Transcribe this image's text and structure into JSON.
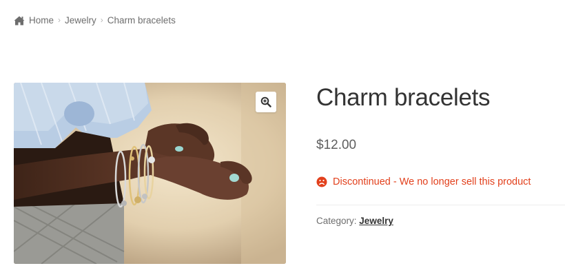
{
  "breadcrumb": {
    "home": "Home",
    "separator": "›",
    "category": "Jewelry",
    "current": "Charm bracelets"
  },
  "product": {
    "title": "Charm bracelets",
    "price": "$12.00",
    "stock_status": "Discontinued - We no longer sell this product",
    "category_label": "Category:",
    "category_link": "Jewelry",
    "image_alt": "Woman's hands wearing charm bracelets"
  },
  "colors": {
    "stock_status": "#e2401c",
    "title": "#333333",
    "muted": "#6d6d6d"
  },
  "icons": {
    "home": "home-icon",
    "zoom": "magnifier-plus-icon",
    "stock": "sad-face-icon"
  }
}
